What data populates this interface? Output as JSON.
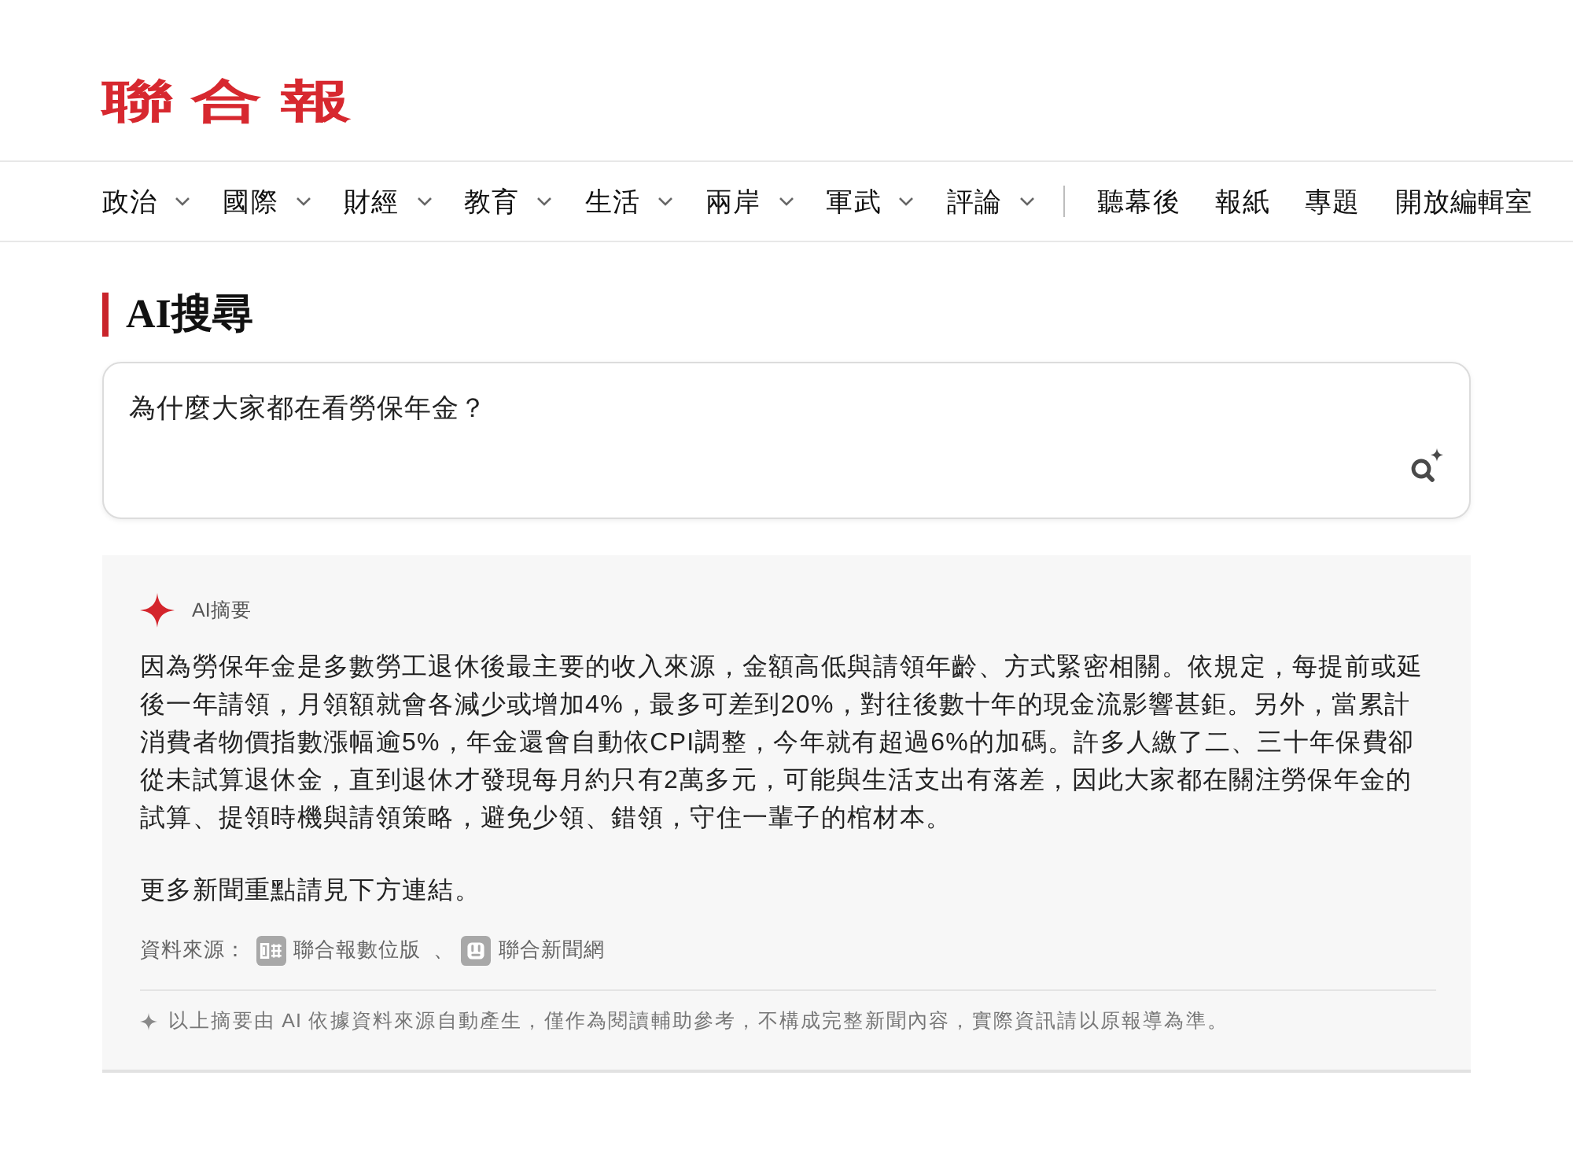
{
  "header": {
    "logo": "聯合報"
  },
  "nav": {
    "menus": [
      "政治",
      "國際",
      "財經",
      "教育",
      "生活",
      "兩岸",
      "軍武",
      "評論"
    ],
    "links": [
      "聽幕後",
      "報紙",
      "專題",
      "開放編輯室"
    ]
  },
  "page_title": "AI搜尋",
  "search": {
    "value": "為什麼大家都在看勞保年金？"
  },
  "summary": {
    "label": "AI摘要",
    "paragraphs": [
      "因為勞保年金是多數勞工退休後最主要的收入來源，金額高低與請領年齡、方式緊密相關。依規定，每提前或延後一年請領，月領額就會各減少或增加4%，最多可差到20%，對往後數十年的現金流影響甚鉅。另外，當累計消費者物價指數漲幅逾5%，年金還會自動依CPI調整，今年就有超過6%的加碼。許多人繳了二、三十年保費卻從未試算退休金，直到退休才發現每月約只有2萬多元，可能與生活支出有落差，因此大家都在關注勞保年金的試算、提領時機與請領策略，避免少領、錯領，守住一輩子的棺材本。",
      "更多新聞重點請見下方連結。"
    ],
    "sources_label": "資料來源：",
    "sources": [
      {
        "name": "聯合報數位版",
        "kind": "paper"
      },
      {
        "name": "聯合新聞網",
        "kind": "web"
      }
    ],
    "separator": "、",
    "disclaimer": "以上摘要由 AI 依據資料來源自動產生，僅作為閱讀輔助參考，不構成完整新聞內容，實際資訊請以原報導為準。"
  }
}
